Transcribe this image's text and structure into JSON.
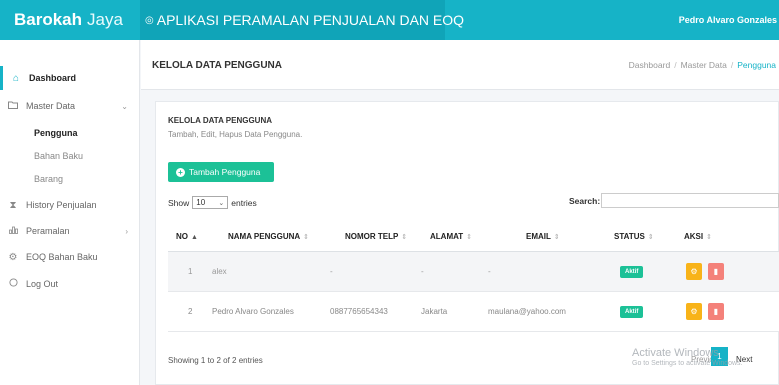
{
  "topbar": {
    "brand_bold": "Barokah",
    "brand_thin": "Jaya",
    "app_icon": "◎",
    "app_title": "APLIKASI PERAMALAN PENJUALAN DAN EOQ",
    "user_name": "Pedro Alvaro Gonzales",
    "bg_color": "#16b3c7"
  },
  "sidebar": {
    "dashboard": {
      "label": "Dashboard",
      "icon": "home-icon"
    },
    "master_data": {
      "label": "Master Data",
      "icon": "folder-icon"
    },
    "sub_items": [
      "Pengguna",
      "Bahan Baku",
      "Barang"
    ],
    "history": {
      "label": "History Penjualan",
      "icon": "hourglass-icon"
    },
    "peramalan": {
      "label": "Peramalan",
      "icon": "bar-chart-icon"
    },
    "eoq": {
      "label": "EOQ Bahan Baku",
      "icon": "gear-icon"
    },
    "logout": {
      "label": "Log Out",
      "icon": "power-icon"
    }
  },
  "header": {
    "title": "KELOLA DATA PENGGUNA",
    "breadcrumb": [
      "Dashboard",
      "Master Data",
      "Pengguna"
    ]
  },
  "card": {
    "title": "KELOLA DATA PENGGUNA",
    "subtitle": "Tambah, Edit, Hapus Data Pengguna.",
    "add_button": "Tambah Pengguna",
    "show_label": "Show",
    "entries_value": "10",
    "entries_label": "entries",
    "search_label": "Search:",
    "search_value": ""
  },
  "table": {
    "headers": [
      "NO",
      "NAMA PENGGUNA",
      "NOMOR TELP",
      "ALAMAT",
      "EMAIL",
      "STATUS",
      "AKSI"
    ],
    "rows": [
      {
        "no": "1",
        "name": "alex",
        "phone": "-",
        "address": "-",
        "email": "-",
        "status": "Aktif"
      },
      {
        "no": "2",
        "name": "Pedro Alvaro Gonzales",
        "phone": "0887765654343",
        "address": "Jakarta",
        "email": "maulana@yahoo.com",
        "status": "Aktif"
      }
    ]
  },
  "footer": {
    "info": "Showing 1 to 2 of 2 entries",
    "prev": "Previous",
    "page": "1",
    "next": "Next"
  },
  "watermark": {
    "line1": "Activate Windows",
    "line2": "Go to Settings to activate Windows."
  },
  "colors": {
    "accent": "#16b3c7",
    "success": "#1cc197",
    "warning": "#f8b319",
    "danger": "#f4817a"
  }
}
